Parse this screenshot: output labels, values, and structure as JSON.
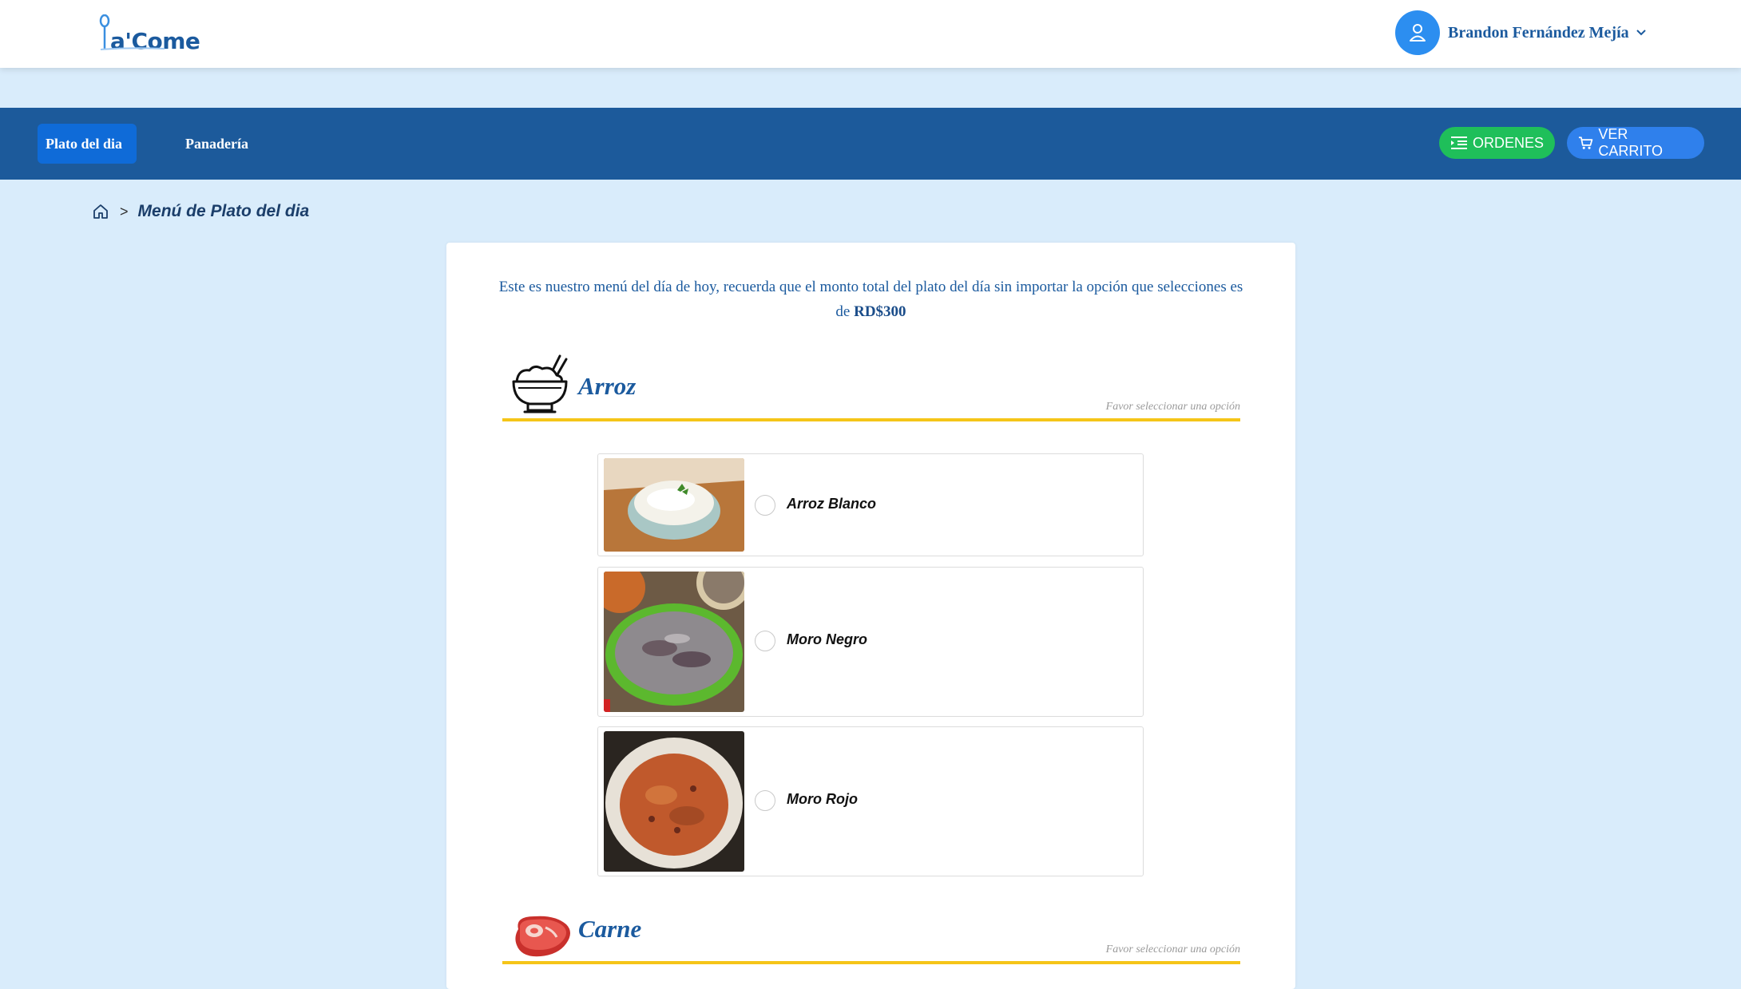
{
  "header": {
    "logo_text": "a'Come",
    "user_name": "Brandon Fernández Mejía"
  },
  "nav": {
    "items": [
      {
        "label": "Plato del dia",
        "active": true
      },
      {
        "label": "Panadería",
        "active": false
      }
    ],
    "orders_label": "ORDENES",
    "cart_label": "VER CARRITO"
  },
  "breadcrumb": {
    "separator": ">",
    "current": "Menú de Plato del dia"
  },
  "intro": {
    "text": "Este es nuestro menú del día de hoy, recuerda que el monto total del plato del día sin importar la opción que selecciones es de ",
    "price": "RD$300"
  },
  "sections": [
    {
      "title": "Arroz",
      "hint": "Favor seleccionar una opción",
      "options": [
        {
          "label": "Arroz Blanco",
          "selected": false
        },
        {
          "label": "Moro Negro",
          "selected": false
        },
        {
          "label": "Moro Rojo",
          "selected": false
        }
      ]
    },
    {
      "title": "Carne",
      "hint": "Favor seleccionar una opción",
      "options": []
    }
  ],
  "colors": {
    "brand": "#1b5a9e",
    "navbar": "#1c5a9b",
    "active_tab": "#0f6bd8",
    "orders_button": "#1fbf5a",
    "cart_button": "#2f80ec",
    "section_underline": "#f5c518",
    "page_background": "#d9ecfb"
  },
  "icons": [
    "spoon-logo-icon",
    "user-icon",
    "chevron-down-icon",
    "list-icon",
    "cart-icon",
    "home-icon",
    "rice-bowl-icon",
    "steak-icon"
  ]
}
